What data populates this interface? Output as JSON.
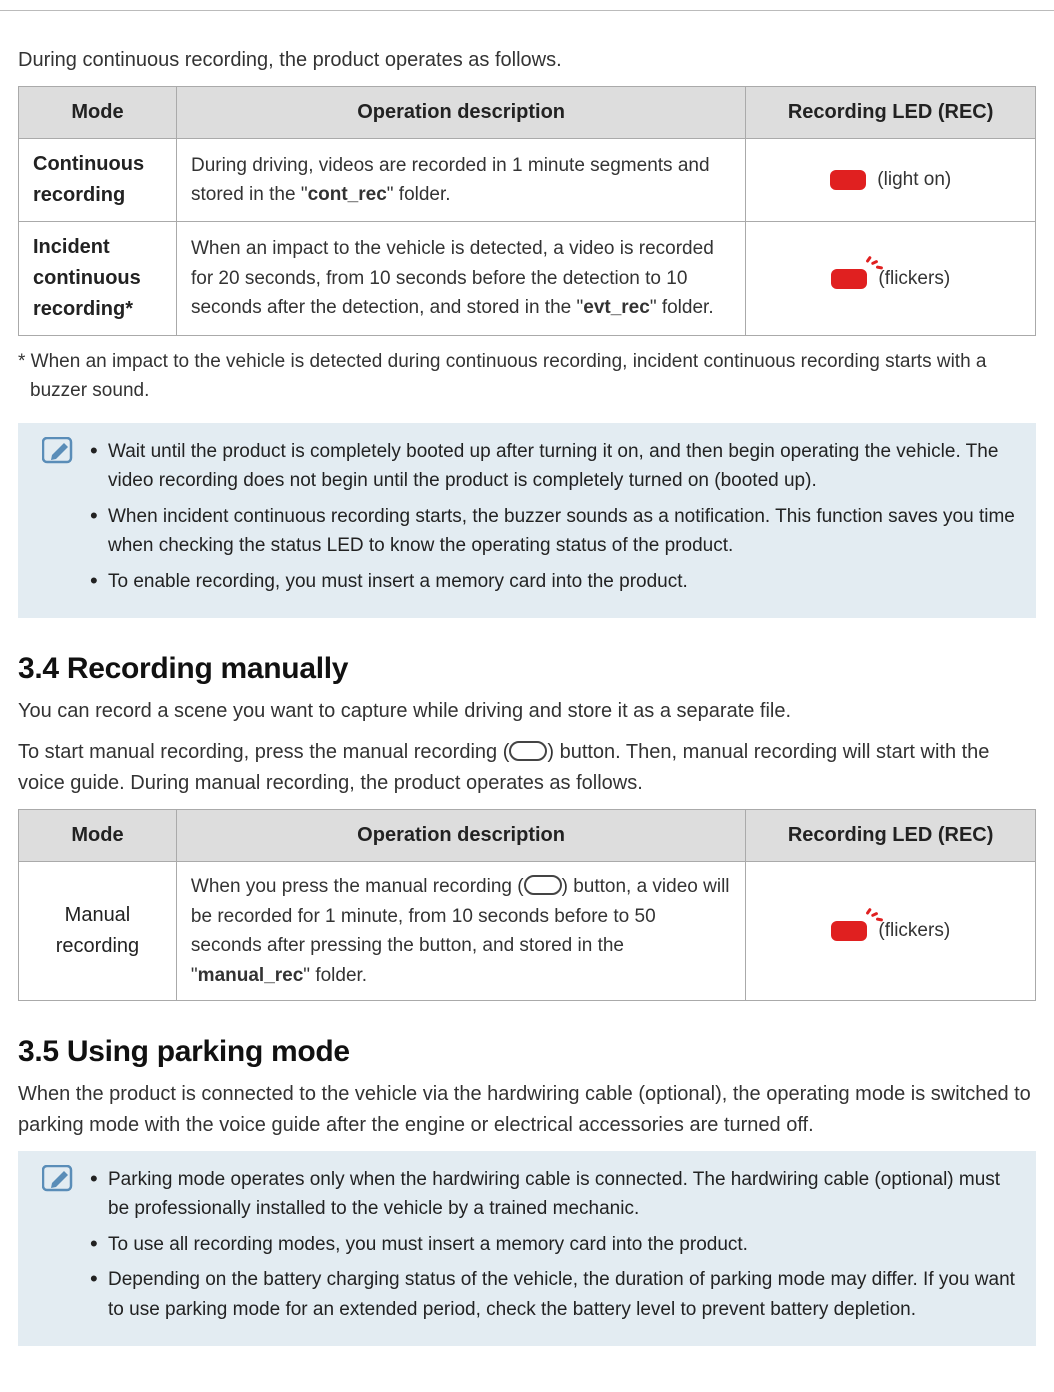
{
  "intro": "During continuous recording, the product operates as follows.",
  "table1": {
    "headers": {
      "mode": "Mode",
      "desc": "Operation description",
      "led": "Recording LED (REC)"
    },
    "rows": [
      {
        "mode": "Continuous recording",
        "desc_pre": "During driving, videos are recorded in 1 minute segments and stored in the \"",
        "folder": "cont_rec",
        "desc_post": "\" folder.",
        "led_label": "(light on)",
        "flicker": false
      },
      {
        "mode": "Incident continuous recording*",
        "desc_pre": "When an impact to the vehicle is detected, a video is recorded for 20 seconds, from 10 seconds before the detection to 10 seconds after the detection, and stored in the \"",
        "folder": "evt_rec",
        "desc_post": "\" folder.",
        "led_label": "(flickers)",
        "flicker": true
      }
    ]
  },
  "footnote": "* When an impact to the vehicle is detected during continuous recording, incident continuous recording starts with a buzzer sound.",
  "note1": {
    "items": [
      "Wait until the product is completely booted up after turning it on, and then begin operating the vehicle. The video recording does not begin until the product is completely turned on (booted up).",
      "When incident continuous recording starts, the buzzer sounds as a notification. This function saves you time when checking the status LED to know the operating status of the product.",
      "To enable recording, you must insert a memory card into the product."
    ]
  },
  "s34": {
    "heading": "3.4   Recording manually",
    "p1": "You can record a scene you want to capture while driving and store it as a separate file.",
    "p2_pre": "To start manual recording, press the manual recording (",
    "p2_post": ") button. Then, manual recording will start with the voice guide. During manual recording, the product operates as follows."
  },
  "table2": {
    "headers": {
      "mode": "Mode",
      "desc": "Operation description",
      "led": "Recording LED (REC)"
    },
    "row": {
      "mode": "Manual recording",
      "desc_pre": "When you press the manual recording (",
      "desc_mid": ") button, a video will be recorded for 1 minute, from 10 seconds before to 50 seconds after pressing the button, and stored in the \"",
      "folder": "manual_rec",
      "desc_post": "\" folder.",
      "led_label": "(flickers)"
    }
  },
  "s35": {
    "heading": "3.5   Using parking mode",
    "p1": "When the product is connected to the vehicle via the hardwiring cable (optional), the operating mode is switched to parking mode with the voice guide after the engine or electrical accessories are turned off."
  },
  "note2": {
    "items": [
      "Parking mode operates only when the hardwiring cable is connected. The hardwiring cable (optional) must be professionally installed to the vehicle by a trained mechanic.",
      "To use all recording modes, you must insert a memory card into the product.",
      "Depending on the battery charging status of the vehicle, the duration of parking mode may differ. If you want to use parking mode for an extended period, check the battery level to prevent battery depletion."
    ]
  }
}
